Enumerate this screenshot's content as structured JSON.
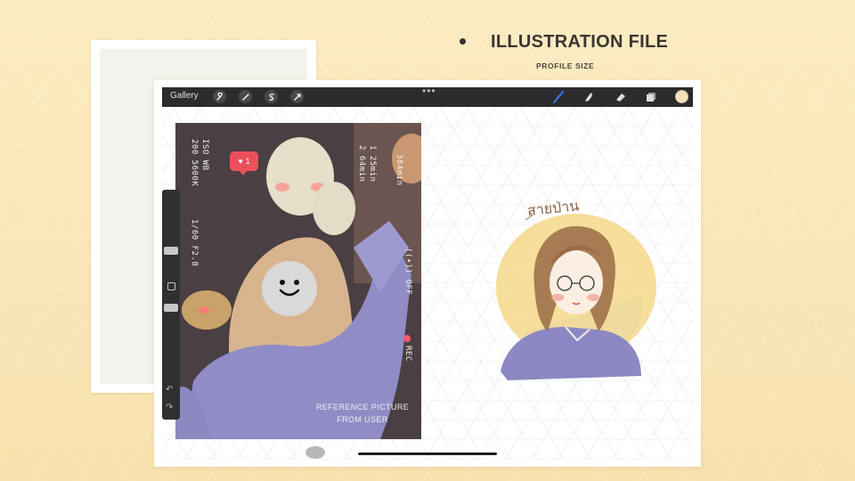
{
  "header": {
    "title": "ILLUSTRATION FILE",
    "subtitle": "PROFILE SIZE"
  },
  "toolbar": {
    "gallery_label": "Gallery",
    "left_tools": [
      "wrench-icon",
      "magic-wand-icon",
      "selection-icon",
      "transform-arrow-icon"
    ],
    "right_tools": [
      "brush-icon",
      "smudge-icon",
      "eraser-icon",
      "layers-icon"
    ],
    "current_color": "#f5e2bb",
    "more_label": "•••"
  },
  "photo": {
    "iso_label": "ISO  WB",
    "iso_values": "200  5600K",
    "exposure": "1/60  F2.8",
    "stats_a": "1  25min",
    "stats_b": "2  64min",
    "battery": "384min",
    "wifi": "((•)) OFF",
    "rec": "REC",
    "heart_count": "1",
    "caption_line1": "REFERENCE PICTURE",
    "caption_line2": "FROM USER"
  },
  "illustration": {
    "handwritten_text": "สายป่าน"
  },
  "colors": {
    "background": "#f8e6b6",
    "toolbar": "#2c2c2e",
    "accent_blue": "#3a78ff",
    "heart_red": "#ee4f5d",
    "sweater": "#8c88c4",
    "hair": "#9a6b45",
    "halo": "#f2d37a"
  }
}
